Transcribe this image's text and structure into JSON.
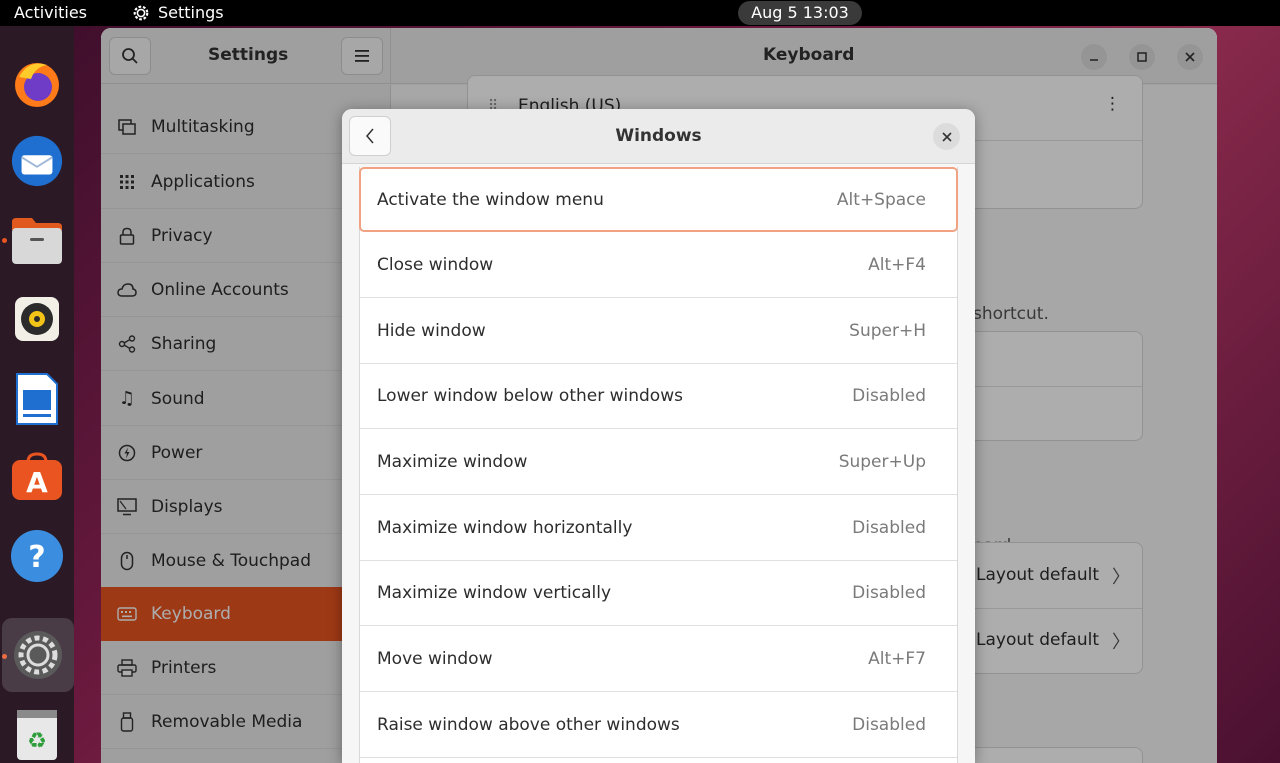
{
  "topbar": {
    "activities": "Activities",
    "app_name": "Settings",
    "clock": "Aug 5  13:03"
  },
  "dock": {
    "items": [
      "firefox-icon",
      "thunderbird-icon",
      "files-icon",
      "rhythmbox-icon",
      "writer-icon",
      "app-center-icon",
      "help-icon",
      "settings-icon",
      "trash-icon"
    ]
  },
  "sidebar": {
    "title": "Settings",
    "items": [
      {
        "label": "Multitasking",
        "icon": "multitasking-icon"
      },
      {
        "label": "Applications",
        "icon": "applications-icon"
      },
      {
        "label": "Privacy",
        "icon": "lock-icon"
      },
      {
        "label": "Online Accounts",
        "icon": "cloud-icon"
      },
      {
        "label": "Sharing",
        "icon": "share-icon"
      },
      {
        "label": "Sound",
        "icon": "music-note-icon"
      },
      {
        "label": "Power",
        "icon": "power-icon"
      },
      {
        "label": "Displays",
        "icon": "display-icon"
      },
      {
        "label": "Mouse & Touchpad",
        "icon": "mouse-icon"
      },
      {
        "label": "Keyboard",
        "icon": "keyboard-icon"
      },
      {
        "label": "Printers",
        "icon": "printer-icon"
      },
      {
        "label": "Removable Media",
        "icon": "usb-icon"
      }
    ]
  },
  "main": {
    "title": "Keyboard",
    "input_source": "English (US)",
    "hint_shortcut": "shortcut.",
    "hint_keyboard": "oard.",
    "layout_default_1": "Layout default",
    "layout_default_2": "Layout default"
  },
  "dialog": {
    "title": "Windows",
    "shortcuts": [
      {
        "label": "Activate the window menu",
        "accel": "Alt+Space"
      },
      {
        "label": "Close window",
        "accel": "Alt+F4"
      },
      {
        "label": "Hide window",
        "accel": "Super+H"
      },
      {
        "label": "Lower window below other windows",
        "accel": "Disabled"
      },
      {
        "label": "Maximize window",
        "accel": "Super+Up"
      },
      {
        "label": "Maximize window horizontally",
        "accel": "Disabled"
      },
      {
        "label": "Maximize window vertically",
        "accel": "Disabled"
      },
      {
        "label": "Move window",
        "accel": "Alt+F7"
      },
      {
        "label": "Raise window above other windows",
        "accel": "Disabled"
      }
    ]
  },
  "colors": {
    "accent": "#e95420",
    "focus_ring": "#f0a283"
  }
}
